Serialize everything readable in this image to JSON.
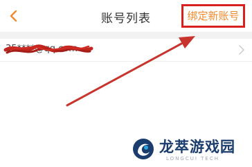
{
  "header": {
    "back_icon": "chevron-left-icon",
    "title": "账号列表",
    "bind_button_label": "绑定新账号"
  },
  "account_list": {
    "rows": [
      {
        "account": "35****@qq.com",
        "chevron_icon": "chevron-right-icon"
      }
    ]
  },
  "watermark": {
    "brand": "龙萃游戏园",
    "sub": "LONGCUI TECH"
  },
  "colors": {
    "accent": "#f08a2c",
    "highlight_box": "#d8211f",
    "arrow": "#c8342d",
    "watermark_blue": "#1b3d6e"
  }
}
